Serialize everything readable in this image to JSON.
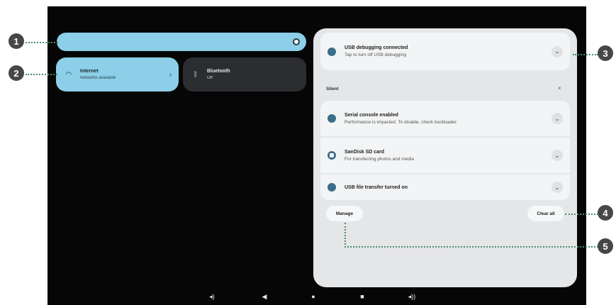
{
  "quick_settings": {
    "tiles": [
      {
        "title": "Internet",
        "subtitle": "Networks available",
        "icon": "wifi-icon"
      },
      {
        "title": "Bluetooth",
        "subtitle": "Off",
        "icon": "bluetooth-icon"
      }
    ]
  },
  "notifications": {
    "alerting": [
      {
        "title": "USB debugging connected",
        "body": "Tap to turn off USB debugging",
        "icon": "android-debug-icon"
      }
    ],
    "silent_header": "Silent",
    "silent": [
      {
        "title": "Serial console enabled",
        "body": "Performance is impacted. To disable, check bootloader.",
        "icon": "console-icon"
      },
      {
        "title": "SanDisk SD card",
        "body": "For transferring photos and media",
        "icon": "sd-card-icon"
      },
      {
        "title": "USB file transfer turned on",
        "body": "",
        "icon": "usb-icon"
      }
    ],
    "manage_label": "Manage",
    "clear_all_label": "Clear all"
  },
  "nav_bar": [
    "volume-down-icon",
    "back-icon",
    "home-icon",
    "recents-icon",
    "volume-up-icon"
  ],
  "callouts": [
    "1",
    "2",
    "3",
    "4",
    "5"
  ],
  "colors": {
    "accent": "#8dcfe8",
    "shade": "#e5e6e7",
    "callout_line": "#4a8a6a",
    "screen": "#060606"
  }
}
